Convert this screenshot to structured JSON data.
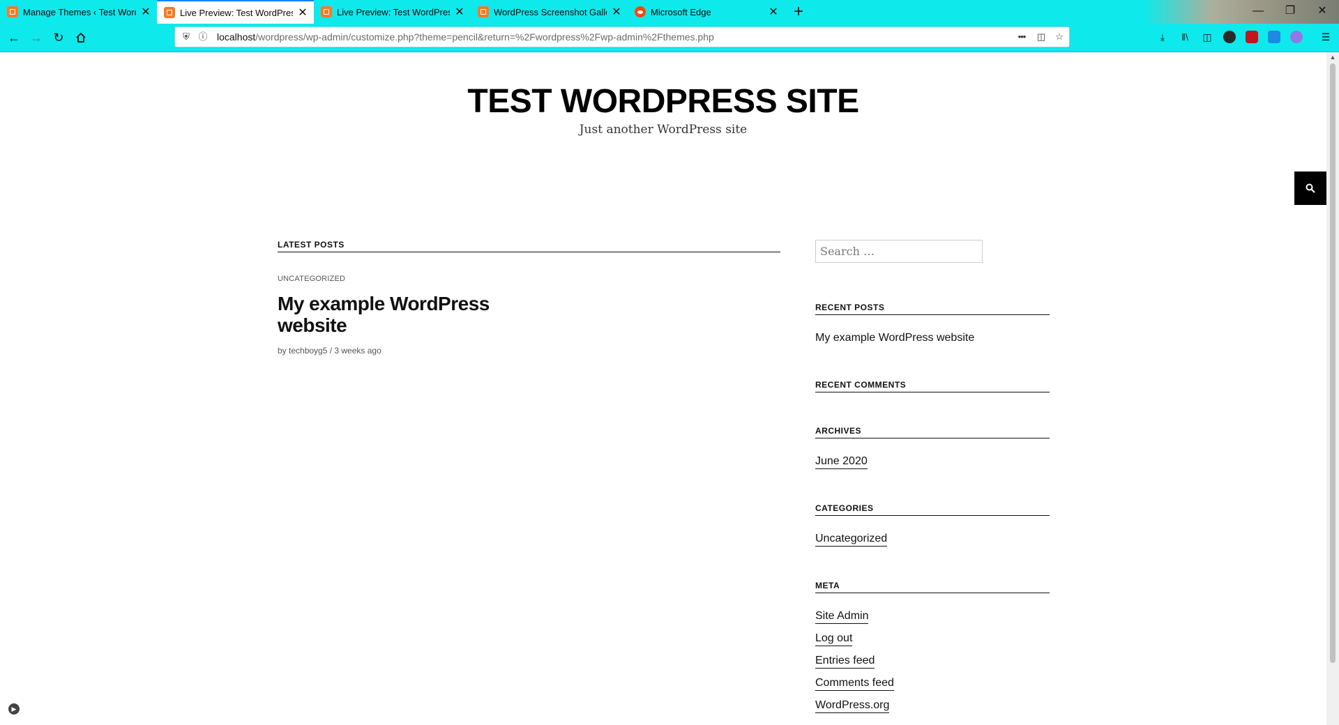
{
  "browser": {
    "tabs": [
      {
        "title": "Manage Themes ‹ Test WordPress Site",
        "favicon": "xampp-icon",
        "active": false
      },
      {
        "title": "Live Preview: Test WordPress Site",
        "favicon": "xampp-icon",
        "active": true
      },
      {
        "title": "Live Preview: Test WordPress Site",
        "favicon": "xampp-icon",
        "active": false
      },
      {
        "title": "WordPress Screenshot Gallery",
        "favicon": "xampp-icon",
        "active": false
      },
      {
        "title": "Microsoft Edge",
        "favicon": "reddit-icon",
        "active": false
      }
    ],
    "new_tab_label": "+",
    "url_host": "localhost",
    "url_path": "/wordpress/wp-admin/customize.php?theme=pencil&return=%2Fwordpress%2Fwp-admin%2Fthemes.php",
    "page_actions_label": "•••",
    "accent_color": "#0ee9ec"
  },
  "site": {
    "title": "TEST WORDPRESS SITE",
    "description": "Just another WordPress site"
  },
  "main": {
    "section_heading": "LATEST POSTS",
    "post": {
      "category": "UNCATEGORIZED",
      "title": "My example WordPress website",
      "meta": "by techboyg5 / 3 weeks ago"
    }
  },
  "sidebar": {
    "search_placeholder": "Search …",
    "recent_posts_heading": "RECENT POSTS",
    "recent_posts": [
      "My example WordPress website"
    ],
    "recent_comments_heading": "RECENT COMMENTS",
    "archives_heading": "ARCHIVES",
    "archives": [
      "June 2020"
    ],
    "categories_heading": "CATEGORIES",
    "categories": [
      "Uncategorized"
    ],
    "meta_heading": "META",
    "meta_links": [
      "Site Admin",
      "Log out",
      "Entries feed",
      "Comments feed",
      "WordPress.org"
    ]
  }
}
